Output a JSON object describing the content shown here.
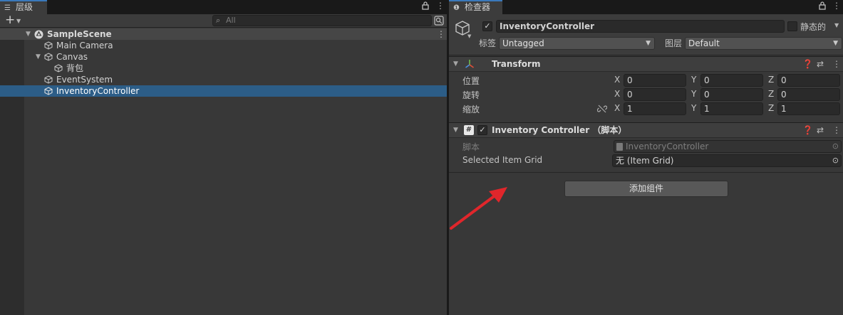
{
  "hierarchy": {
    "tab_label": "层级",
    "add_label": "+",
    "search_placeholder": "All",
    "scene": "SampleScene",
    "objects": [
      "Main Camera",
      "Canvas",
      "背包",
      "EventSystem",
      "InventoryController"
    ]
  },
  "inspector": {
    "tab_label": "检查器",
    "object_name": "InventoryController",
    "active": true,
    "static_label": "静态的",
    "tag_label": "标签",
    "tag_value": "Untagged",
    "layer_label": "图层",
    "layer_value": "Default",
    "transform": {
      "title": "Transform",
      "position_label": "位置",
      "rotation_label": "旋转",
      "scale_label": "缩放",
      "axes": [
        "X",
        "Y",
        "Z"
      ],
      "position": [
        "0",
        "0",
        "0"
      ],
      "rotation": [
        "0",
        "0",
        "0"
      ],
      "scale": [
        "1",
        "1",
        "1"
      ]
    },
    "script_component": {
      "title": "Inventory Controller （脚本）",
      "script_label": "脚本",
      "script_value": "InventoryController",
      "field_label": "Selected Item Grid",
      "field_value": "无 (Item Grid)"
    },
    "add_component_label": "添加组件"
  },
  "colors": {
    "selection": "#2c5d87",
    "tab_accent": "#3a79bb",
    "annotation_arrow": "#e0262b"
  }
}
